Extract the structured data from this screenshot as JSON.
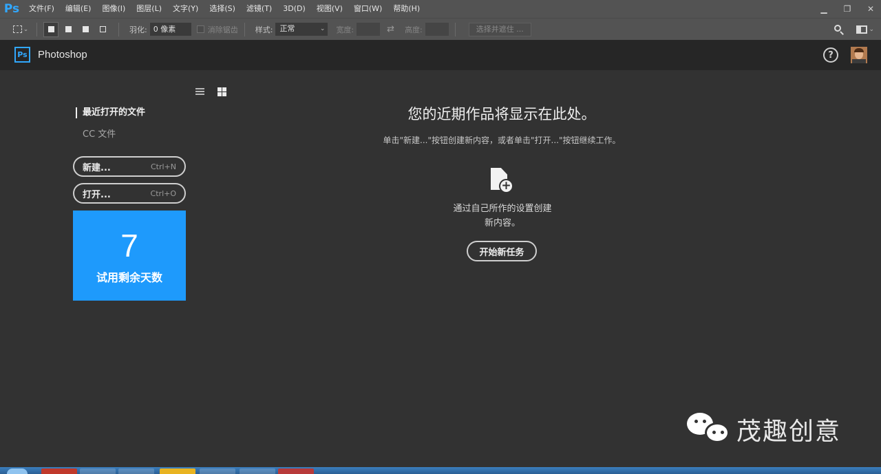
{
  "app": {
    "logo": "Ps",
    "title": "Photoshop",
    "logo_box": "Ps"
  },
  "menu": [
    "文件(F)",
    "编辑(E)",
    "图像(I)",
    "图层(L)",
    "文字(Y)",
    "选择(S)",
    "滤镜(T)",
    "3D(D)",
    "视图(V)",
    "窗口(W)",
    "帮助(H)"
  ],
  "window_controls": {
    "minimize": "▁",
    "restore": "❐",
    "close": "✕"
  },
  "options": {
    "feather_label": "羽化:",
    "feather_value": "0 像素",
    "antialias_label": "消除锯齿",
    "style_label": "样式:",
    "style_value": "正常",
    "width_label": "宽度:",
    "height_label": "高度:",
    "refine_label": "选择并遮住 ...",
    "swap_glyph": "⇄"
  },
  "header": {
    "help_glyph": "?"
  },
  "sidebar": {
    "recent_label": "最近打开的文件",
    "cc_label": "CC 文件",
    "new_button": {
      "label": "新建...",
      "shortcut": "Ctrl+N"
    },
    "open_button": {
      "label": "打开...",
      "shortcut": "Ctrl+O"
    },
    "trial": {
      "days": "7",
      "label": "试用剩余天数"
    }
  },
  "main": {
    "headline": "您的近期作品将显示在此处。",
    "subline": "单击\"新建...\"按钮创建新内容，或者单击\"打开...\"按钮继续工作。",
    "create_line1": "通过自己所作的设置创建",
    "create_line2": "新内容。",
    "start_button": "开始新任务",
    "plus_glyph": "+"
  },
  "watermark": {
    "text": "茂趣创意"
  },
  "colors": {
    "accent": "#31a8ff",
    "trial_bg": "#1e9afc",
    "bg": "#323232"
  },
  "icons": [
    "ps-logo-icon",
    "marquee-icon",
    "search-icon",
    "workspace-icon",
    "help-icon",
    "list-view-icon",
    "grid-view-icon",
    "new-document-icon",
    "wechat-icon"
  ]
}
